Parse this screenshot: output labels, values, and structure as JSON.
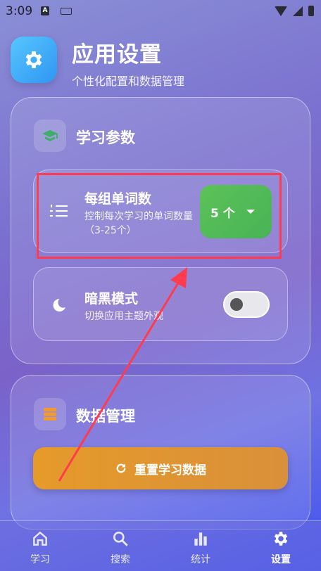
{
  "status_bar": {
    "time": "3:09",
    "app_badge": "A"
  },
  "header": {
    "title": "应用设置",
    "subtitle": "个性化配置和数据管理",
    "app_icon": "gear-icon"
  },
  "learning_section": {
    "title": "学习参数",
    "icon": "graduation-cap-icon",
    "words_per_group": {
      "title": "每组单词数",
      "description": "控制每次学习的单词数量（3-25个）",
      "icon": "numbered-list-icon",
      "selected_value": "5 个"
    },
    "dark_mode": {
      "title": "暗黑模式",
      "description": "切换应用主题外观",
      "icon": "moon-icon",
      "enabled": false
    }
  },
  "data_section": {
    "title": "数据管理",
    "icon": "database-icon",
    "reset_button_label": "重置学习数据"
  },
  "colors": {
    "accent_green": "#5cc257",
    "reset_orange": "#e69a2a",
    "annotation_red": "#ff3b4f",
    "app_icon_blue": "#3aa8f6"
  },
  "bottom_nav": {
    "active": "设置",
    "items": [
      {
        "label": "学习",
        "icon": "home-icon"
      },
      {
        "label": "搜索",
        "icon": "search-icon"
      },
      {
        "label": "统计",
        "icon": "bar-chart-icon"
      },
      {
        "label": "设置",
        "icon": "gear-icon"
      }
    ]
  }
}
